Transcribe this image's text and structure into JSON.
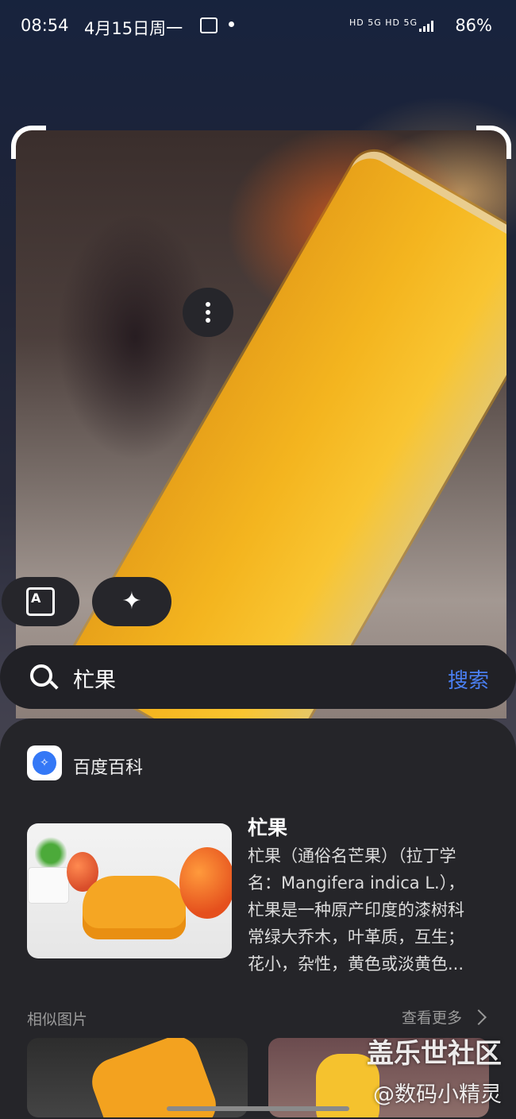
{
  "status_bar": {
    "time": "08:54",
    "date": "4月15日周一",
    "network": "HD 5G HD 5G",
    "battery": "86%"
  },
  "toolbar": {
    "translate_icon": "translate-icon",
    "magic_icon": "sparkle-icon",
    "more_icon": "more-vertical-icon"
  },
  "search": {
    "query": "杧果",
    "button_label": "搜索"
  },
  "result": {
    "source_name": "百度百科",
    "title": "杧果",
    "description_lines": [
      "杧果（通俗名芒果）（拉丁学",
      "名：Mangifera indica L.），",
      "杧果是一种原产印度的漆树科",
      "常绿大乔木，叶革质，互生；",
      "花小，杂性，黄色或淡黄色..."
    ]
  },
  "similar": {
    "section_label": "相似图片",
    "more_label": "查看更多"
  },
  "watermark": {
    "line1": "盖乐世社区",
    "line2": "@数码小精灵"
  },
  "colors": {
    "accent": "#4a7ff2",
    "panel": "#252529"
  }
}
